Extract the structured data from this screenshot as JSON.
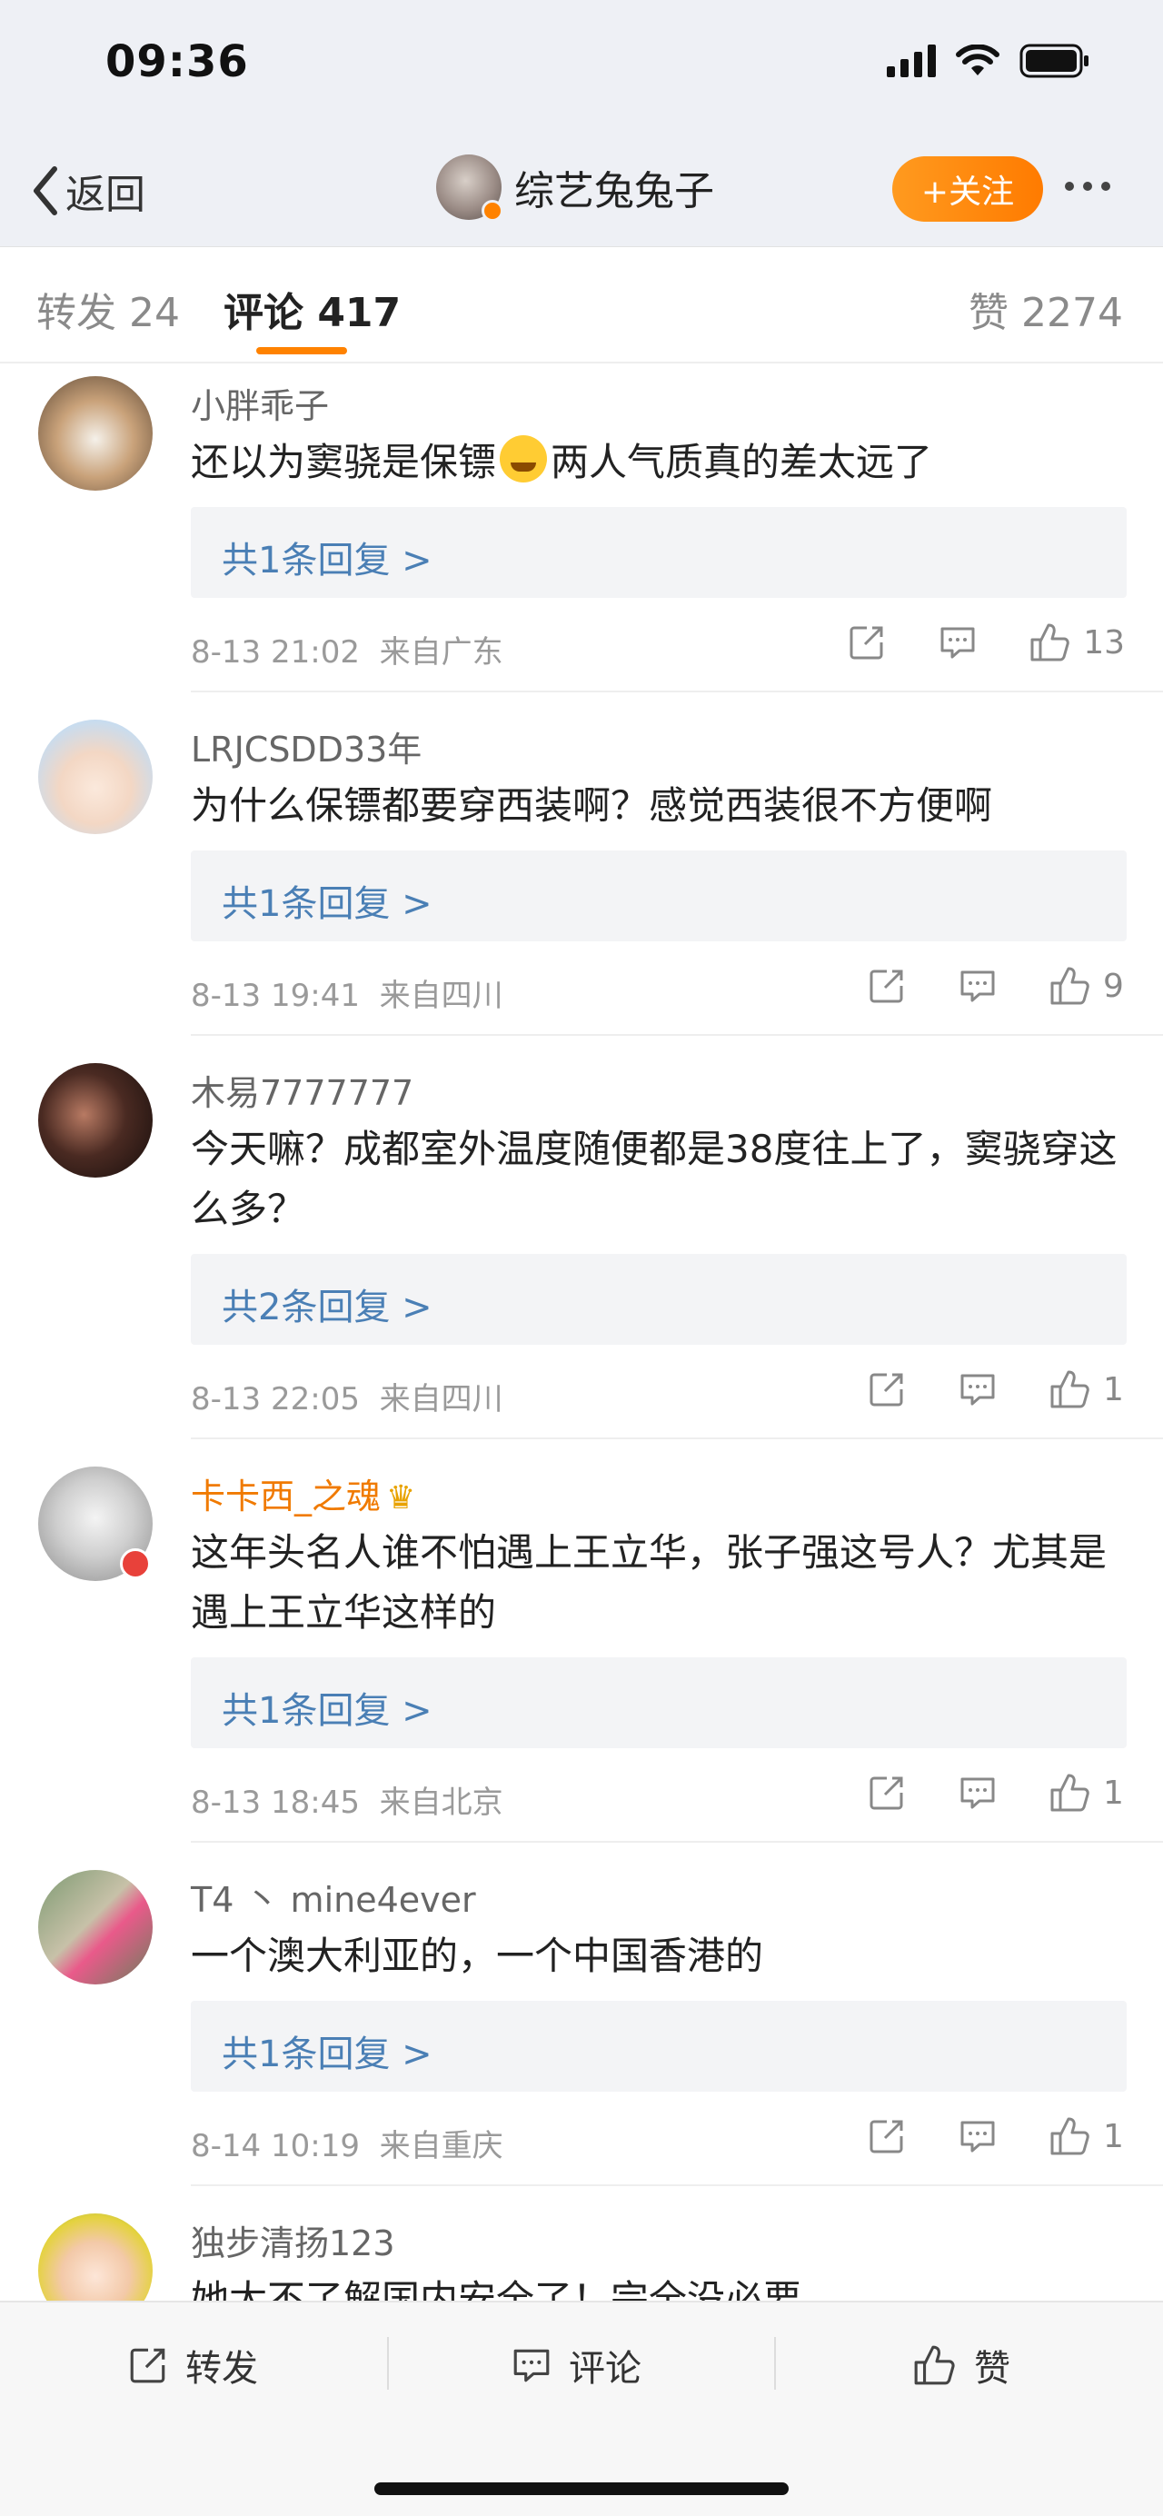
{
  "status_bar": {
    "time": "09:36"
  },
  "nav": {
    "back_label": "返回",
    "account_name": "综艺兔兔子",
    "follow_label": "+关注"
  },
  "tabs": {
    "repost": "转发 24",
    "comment": "评论 417",
    "like": "赞 2274"
  },
  "comments": [
    {
      "name": "小胖乖子",
      "text_before": "还以为窦骁是保镖",
      "text_after": "两人气质真的差太远了",
      "reply_link": "共1条回复 >",
      "time": "8-13 21:02",
      "location": "来自广东",
      "likes": "13"
    },
    {
      "name": "LRJCSDD33年",
      "text": "为什么保镖都要穿西装啊？感觉西装很不方便啊",
      "reply_link": "共1条回复 >",
      "time": "8-13 19:41",
      "location": "来自四川",
      "likes": "9"
    },
    {
      "name": "木易7777777",
      "text": "今天嘛？成都室外温度随便都是38度往上了，窦骁穿这么多？",
      "reply_link": "共2条回复 >",
      "time": "8-13 22:05",
      "location": "来自四川",
      "likes": "1"
    },
    {
      "name": "卡卡西_之魂",
      "text": "这年头名人谁不怕遇上王立华，张子强这号人？尤其是遇上王立华这样的",
      "reply_link": "共1条回复 >",
      "time": "8-13 18:45",
      "location": "来自北京",
      "likes": "1"
    },
    {
      "name": "T4 丶 mine4ever",
      "text": "一个澳大利亚的，一个中国香港的",
      "reply_link": "共1条回复 >",
      "time": "8-14 10:19",
      "location": "来自重庆",
      "likes": "1"
    },
    {
      "name": "独步清扬123",
      "text": "她太不了解国内安全了！完全没必要"
    }
  ],
  "bottom_bar": {
    "repost": "转发",
    "comment": "评论",
    "like": "赞"
  },
  "colors": {
    "accent": "#ff8200",
    "link": "#4a7fb5",
    "vip_name": "#f07a00"
  }
}
